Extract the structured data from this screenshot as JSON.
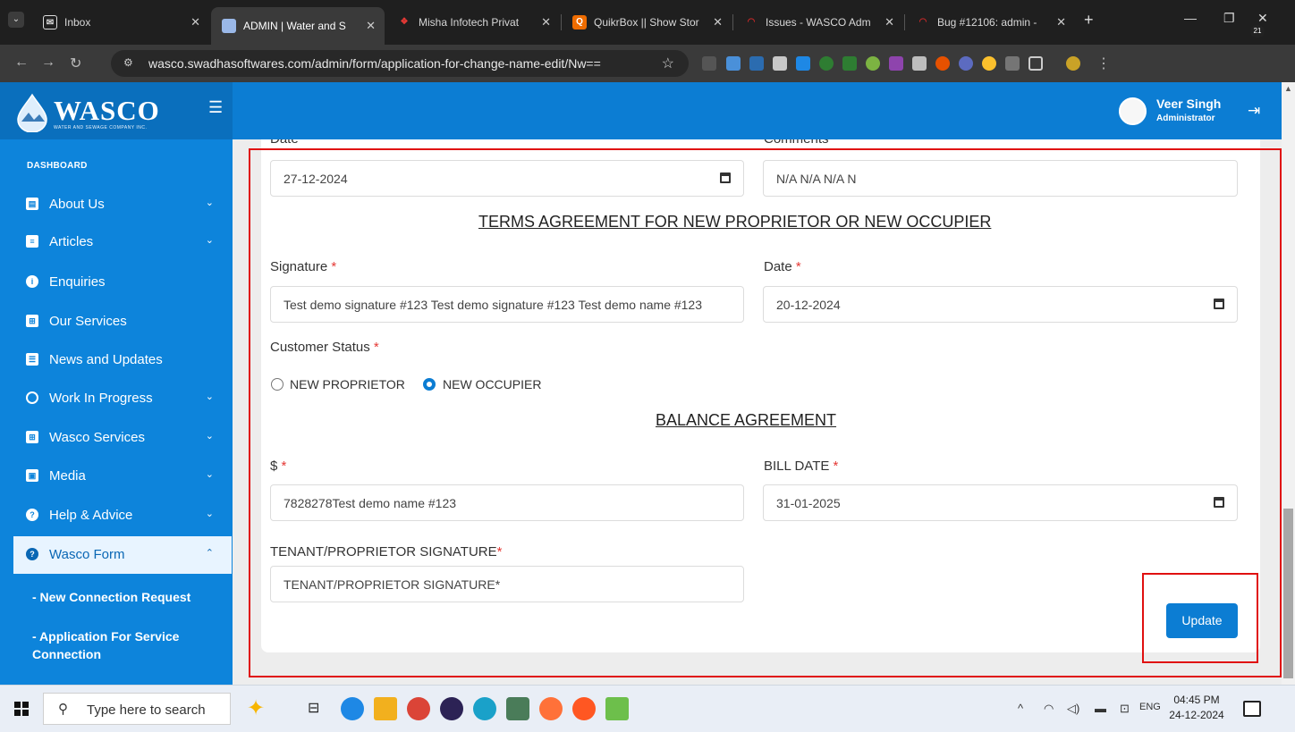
{
  "browser": {
    "tabs": [
      {
        "title": "Inbox",
        "favicon_color": "#1f1f1f"
      },
      {
        "title": "ADMIN | Water and S",
        "favicon_color": "#9ab8e8",
        "active": true
      },
      {
        "title": "Misha Infotech Privat",
        "favicon_color": "#e53935"
      },
      {
        "title": "QuikrBox || Show Stor",
        "favicon_color": "#ef6c00"
      },
      {
        "title": "Issues - WASCO Adm",
        "favicon_color": "#c62828"
      },
      {
        "title": "Bug #12106: admin -",
        "favicon_color": "#c62828"
      }
    ],
    "new_tab": "+",
    "url": "wasco.swadhasoftwares.com/admin/form/application-for-change-name-edit/Nw=="
  },
  "app": {
    "brand_name": "WASCO",
    "brand_sub": "WATER AND SEWAGE COMPANY INC.",
    "user_name": "Veer Singh",
    "user_role": "Administrator"
  },
  "sidebar": {
    "caption": "DASHBOARD",
    "items": [
      {
        "label": "About Us",
        "icon": "book-icon",
        "chevron": "⌄"
      },
      {
        "label": "Articles",
        "icon": "article-icon",
        "chevron": "⌄"
      },
      {
        "label": "Enquiries",
        "icon": "info-icon",
        "chevron": ""
      },
      {
        "label": "Our Services",
        "icon": "grid-icon",
        "chevron": ""
      },
      {
        "label": "News and Updates",
        "icon": "newspaper-icon",
        "chevron": ""
      },
      {
        "label": "Work In Progress",
        "icon": "circle-icon",
        "chevron": "⌄"
      },
      {
        "label": "Wasco Services",
        "icon": "grid-icon",
        "chevron": "⌄"
      },
      {
        "label": "Media",
        "icon": "image-icon",
        "chevron": "⌄"
      },
      {
        "label": "Help & Advice",
        "icon": "help-icon",
        "chevron": "⌄"
      },
      {
        "label": "Wasco Form",
        "icon": "help-icon",
        "chevron": "⌃"
      }
    ],
    "sub_items": [
      {
        "label": "- New Connection Request"
      },
      {
        "label": "- Application For Service Connection"
      }
    ]
  },
  "form": {
    "date_label": "Date",
    "date_value": "27-12-2024",
    "comments_label": "Comments",
    "comments_value": "N/A  N/A N/A N",
    "terms_title": "TERMS AGREEMENT FOR NEW PROPRIETOR OR NEW OCCUPIER",
    "signature_label": "Signature",
    "signature_value": "Test demo signature #123  Test demo signature #123   Test demo name #123",
    "date2_label": "Date",
    "date2_value": "20-12-2024",
    "customer_status_label": "Customer Status",
    "status_options": [
      {
        "label": "NEW PROPRIETOR",
        "selected": false
      },
      {
        "label": "NEW OCCUPIER",
        "selected": true
      }
    ],
    "balance_title": "BALANCE AGREEMENT",
    "amount_label": "$",
    "amount_value": "7828278Test demo name #123",
    "bill_date_label": "BILL DATE",
    "bill_date_value": "31-01-2025",
    "tenant_sig_label": "TENANT/PROPRIETOR SIGNATURE",
    "tenant_sig_value": "TENANT/PROPRIETOR SIGNATURE*",
    "required_mark": "*",
    "update_label": "Update"
  },
  "taskbar": {
    "search_placeholder": "Type here to search",
    "tray_lang": "ENG",
    "time": "04:45 PM",
    "date": "24-12-2024",
    "notif_count": "21"
  },
  "colors": {
    "header": "#0c7dd3",
    "sidebar": "#0d84db",
    "accent": "#0c7dd3",
    "highlight_box": "#e01010"
  }
}
